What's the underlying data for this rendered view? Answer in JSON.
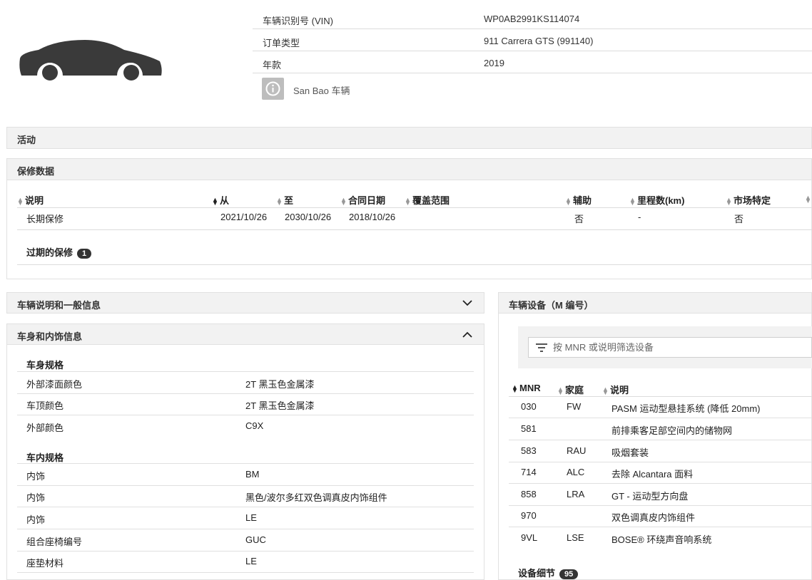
{
  "vehicle": {
    "rows": [
      {
        "label": "车辆识别号 (VIN)",
        "value": "WP0AB2991KS114074"
      },
      {
        "label": "订单类型",
        "value": "911 Carrera GTS (991140)"
      },
      {
        "label": "年款",
        "value": "2019"
      }
    ],
    "sanbao_label": "San Bao 车辆"
  },
  "sections": {
    "activity": "活动",
    "warranty": "保修数据",
    "vehicle_desc": "车辆说明和一般信息",
    "body_interior": "车身和内饰信息",
    "equipment": "车辆设备（M 编号）"
  },
  "warranty_table": {
    "headers": [
      "说明",
      "从",
      "至",
      "合同日期",
      "覆盖范围",
      "辅助",
      "里程数(km)",
      "市场特定"
    ],
    "row": [
      "长期保修",
      "2021/10/26",
      "2030/10/26",
      "2018/10/26",
      "",
      "否",
      "-",
      "否"
    ],
    "expired_label": "过期的保修",
    "expired_count": "1"
  },
  "body_specs": {
    "exterior_heading": "车身规格",
    "exterior": [
      {
        "k": "外部漆面颜色",
        "v": "2T 黑玉色金属漆"
      },
      {
        "k": "车顶颜色",
        "v": "2T 黑玉色金属漆"
      },
      {
        "k": "外部颜色",
        "v": "C9X"
      }
    ],
    "interior_heading": "车内规格",
    "interior": [
      {
        "k": "内饰",
        "v": "BM"
      },
      {
        "k": "内饰",
        "v": "黑色/波尔多红双色调真皮内饰组件"
      },
      {
        "k": "内饰",
        "v": "LE"
      },
      {
        "k": "组合座椅编号",
        "v": "GUC"
      },
      {
        "k": "座垫材料",
        "v": "LE"
      }
    ]
  },
  "equipment": {
    "search_placeholder": "按 MNR 或说明筛选设备",
    "headers": [
      "MNR",
      "家庭",
      "说明"
    ],
    "rows": [
      [
        "030",
        "FW",
        "PASM 运动型悬挂系统 (降低 20mm)"
      ],
      [
        "581",
        "",
        "前排乘客足部空间内的储物网"
      ],
      [
        "583",
        "RAU",
        "吸烟套装"
      ],
      [
        "714",
        "ALC",
        "去除 Alcantara 面料"
      ],
      [
        "858",
        "LRA",
        "GT - 运动型方向盘"
      ],
      [
        "970",
        "",
        "双色调真皮内饰组件"
      ],
      [
        "9VL",
        "LSE",
        "BOSE® 环绕声音响系统"
      ]
    ],
    "footer_label": "设备细节",
    "footer_count": "95"
  },
  "colors": {
    "accent_dark": "#333333",
    "bar_bg": "#f2f2f2"
  },
  "icons": [
    "car-silhouette-icon",
    "info-icon",
    "chevron-down-icon",
    "chevron-up-icon",
    "filter-icon",
    "sort-icon"
  ]
}
